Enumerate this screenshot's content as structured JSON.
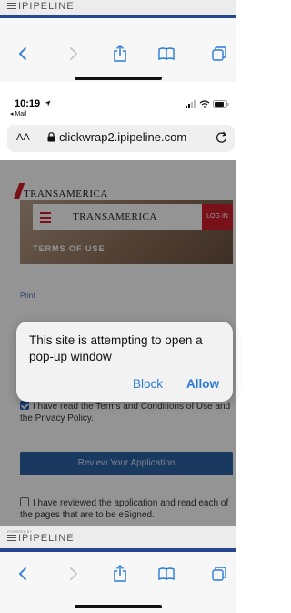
{
  "top_banner": {
    "logo": "IPIPELINE"
  },
  "browser_toolbar": {
    "back": "back-arrow",
    "forward": "forward-arrow",
    "share": "share-icon",
    "bookmarks": "bookmarks-icon",
    "tabs": "tabs-icon"
  },
  "status_bar": {
    "time": "10:19",
    "back_app": "◂ Mail"
  },
  "url_bar": {
    "aa": "AA",
    "url": "clickwrap2.ipipeline.com"
  },
  "page": {
    "brand": "TRANSAMERICA",
    "hero_brand": "TRANSAMERICA",
    "hero_login": "LOG IN",
    "hero_caption": "TERMS OF USE",
    "print": "Print",
    "terms_checkbox": "I have read the Terms and Conditions of Use and the Privacy Policy.",
    "review_button": "Review Your Application",
    "reviewed_checkbox": "I have reviewed the application and read each of the pages that are to be eSigned."
  },
  "alert": {
    "message": "This site is attempting to open a pop-up window",
    "block": "Block",
    "allow": "Allow"
  },
  "bottom_banner": {
    "logo": "IPIPELINE",
    "small_text": "POWERED BY"
  },
  "colors": {
    "accent": "#2a7ad8",
    "brand_red": "#d0202a",
    "rule_blue": "#26478f"
  }
}
